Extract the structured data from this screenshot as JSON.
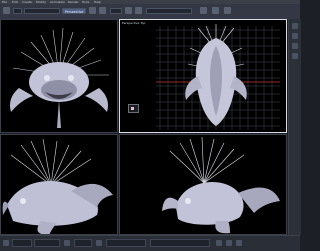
{
  "window": {
    "title": ""
  },
  "menubar": {
    "items": [
      "File",
      "Edit",
      "Create",
      "Modify",
      "Animation",
      "Render",
      "Tools",
      "Help"
    ]
  },
  "toolbar": {
    "fields": [
      {
        "label": ""
      },
      {
        "label": ""
      },
      {
        "label": "Perspective"
      },
      {
        "label": ""
      },
      {
        "label": ""
      }
    ],
    "icons": [
      "select-icon",
      "move-icon",
      "rotate-icon",
      "scale-icon",
      "snap-icon",
      "render-icon",
      "material-icon",
      "camera-icon"
    ]
  },
  "viewports": [
    {
      "name": "perspective",
      "label": "",
      "active": false
    },
    {
      "name": "top",
      "label": "Perspective Top",
      "active": true
    },
    {
      "name": "front-left",
      "label": "",
      "active": false
    },
    {
      "name": "front-right",
      "label": "",
      "active": false
    }
  ],
  "statusbar": {
    "cells": [
      "",
      "",
      "",
      "",
      ""
    ]
  },
  "colors": {
    "model": "#c7c9dc",
    "grid": "#5a5d6a",
    "axis_red": "#c0382e",
    "accent": "#4c5f86"
  }
}
